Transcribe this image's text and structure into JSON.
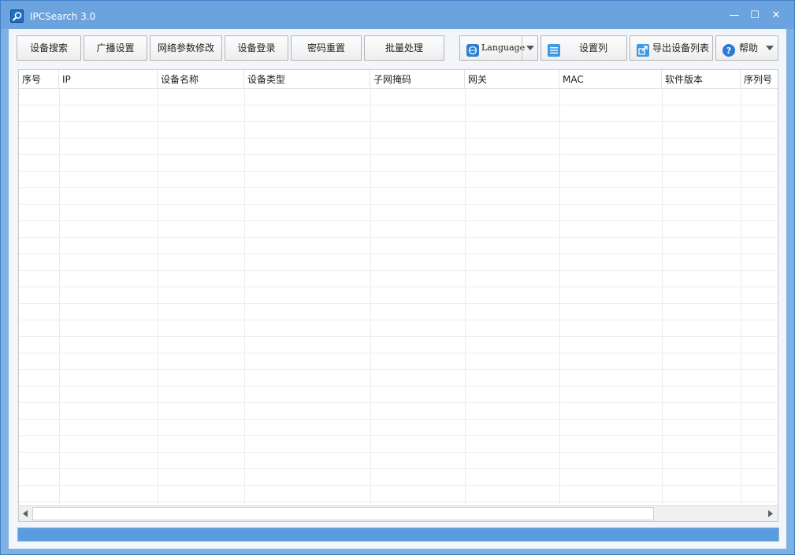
{
  "window": {
    "title": "IPCSearch 3.0",
    "minimize_glyph": "—",
    "maximize_glyph": "☐",
    "close_glyph": "✕"
  },
  "toolbar": {
    "search_label": "设备搜索",
    "broadcast_label": "广播设置",
    "network_label": "网络参数修改",
    "login_label": "设备登录",
    "reset_label": "密码重置",
    "batch_label": "批量处理",
    "language_label": "Language",
    "columns_label": "设置列",
    "export_label": "导出设备列表",
    "help_label": "帮助"
  },
  "table": {
    "columns": [
      "序号",
      "IP",
      "设备名称",
      "设备类型",
      "子网掩码",
      "网关",
      "MAC",
      "软件版本",
      "序列号"
    ],
    "rows": []
  },
  "progress": {
    "value": 1.0
  },
  "icons": {
    "app": "magnifier-icon",
    "language": "globe-icon",
    "columns": "list-icon",
    "export": "export-icon",
    "help": "question-icon"
  },
  "colors": {
    "titlebar": "#6aa3dd",
    "frame": "#7fb0e2",
    "progress_fill": "#5b9be0"
  }
}
